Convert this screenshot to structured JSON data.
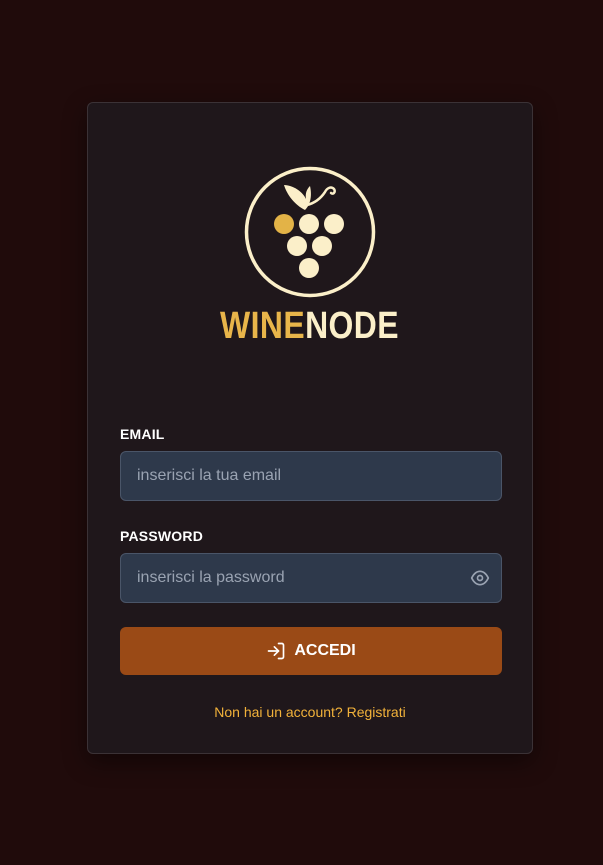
{
  "brand": {
    "name_part1": "WINE",
    "name_part2": "NODE",
    "logo_icon": "grape-cluster-icon"
  },
  "form": {
    "email": {
      "label": "EMAIL",
      "placeholder": "inserisci la tua email",
      "value": ""
    },
    "password": {
      "label": "PASSWORD",
      "placeholder": "inserisci la password",
      "value": "",
      "toggle_icon": "eye-icon"
    },
    "submit": {
      "label": "ACCEDI",
      "icon": "login-icon"
    },
    "register_link": "Non hai un account? Registrati"
  },
  "colors": {
    "page_bg": "#200b0b",
    "card_bg": "#1f171b",
    "input_bg": "#2e394b",
    "accent_button": "#9a4a16",
    "link": "#f2b23a",
    "brand_gold": "#e8b54a",
    "brand_cream": "#fbefc9"
  }
}
